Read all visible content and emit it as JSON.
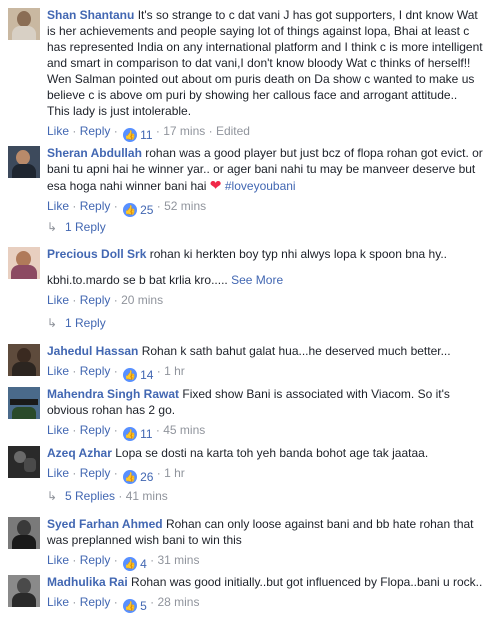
{
  "meta_labels": {
    "like": "Like",
    "reply": "Reply",
    "dot": "·"
  },
  "comments": [
    {
      "name": "Shan Shantanu",
      "text": "It's so strange to c dat vani J has got supporters, I dnt know Wat is her achievements and people saying lot of things against lopa, Bhai at least c has represented India on any international platform and I think c is more intelligent and smart in comparison to dat vani,I don't know bloody Wat c thinks of herself!! Wen Salman pointed out about om puris death on Da show c wanted to make us believe c is above om puri by showing her callous face and arrogant attitude.. This lady is just intolerable.",
      "reactions": "11",
      "time": "17 mins",
      "edited": "Edited"
    },
    {
      "name": "Sheran Abdullah",
      "text": "rohan was a good player but just bcz of flopa rohan got evict. or bani tu apni hai he winner yar.. or ager bani nahi tu may be manveer deserve but esa hoga nahi winner bani hai",
      "hashtag": "#loveyoubani",
      "reactions": "25",
      "time": "52 mins",
      "replies": "1 Reply"
    },
    {
      "name": "Precious Doll Srk",
      "text": "rohan ki herkten boy typ nhi alwys lopa k spoon bna hy..",
      "text2": "kbhi.to.mardo se b bat krlia kro.....",
      "see_more": "See More",
      "time": "20 mins",
      "replies": "1 Reply"
    },
    {
      "name": "Jahedul Hassan",
      "text": "Rohan k sath bahut galat hua...he deserved much better...",
      "reactions": "14",
      "time": "1 hr"
    },
    {
      "name": "Mahendra Singh Rawat",
      "text": "Fixed show Bani is associated with Viacom. So it's obvious rohan has 2 go.",
      "reactions": "11",
      "time": "45 mins"
    },
    {
      "name": "Azeq Azhar",
      "text": "Lopa se dosti na karta toh yeh banda bohot age tak jaataa.",
      "reactions": "26",
      "time": "1 hr",
      "replies": "5 Replies",
      "replies_time": "41 mins"
    },
    {
      "name": "Syed Farhan Ahmed",
      "text": "Rohan can only loose against bani and bb hate rohan that was preplanned wish bani to win this",
      "reactions": "4",
      "time": "31 mins"
    },
    {
      "name": "Madhulika Rai",
      "text": "Rohan was good initially..but got influenced by Flopa..bani u rock..",
      "reactions": "5",
      "time": "28 mins"
    }
  ],
  "colors": {
    "link": "#4267b2",
    "meta": "#90949c",
    "text": "#1d2129",
    "reaction": "#5890ff",
    "heart": "#f02849"
  }
}
